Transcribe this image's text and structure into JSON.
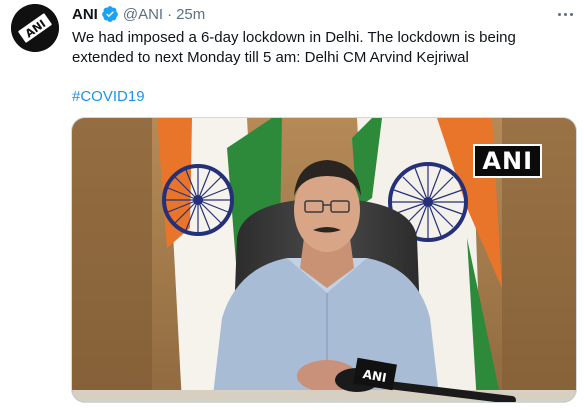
{
  "tweet": {
    "author_name": "ANI",
    "handle": "@ANI",
    "separator": "·",
    "time": "25m",
    "text_line1": "We had imposed a 6-day lockdown in Delhi. The lockdown is being",
    "text_line2": "extended to next Monday till 5 am: Delhi CM Arvind Kejriwal",
    "hashtag": "#COVID19"
  },
  "media": {
    "watermark": "ANI",
    "mic_label": "ANI"
  },
  "icons": {
    "avatar": "ani-logo-avatar",
    "verified": "verified-badge-icon",
    "more": "more-options-icon"
  },
  "colors": {
    "accent": "#1b95e0",
    "secondary_text": "#5b7083",
    "verified": "#1da1f2"
  }
}
